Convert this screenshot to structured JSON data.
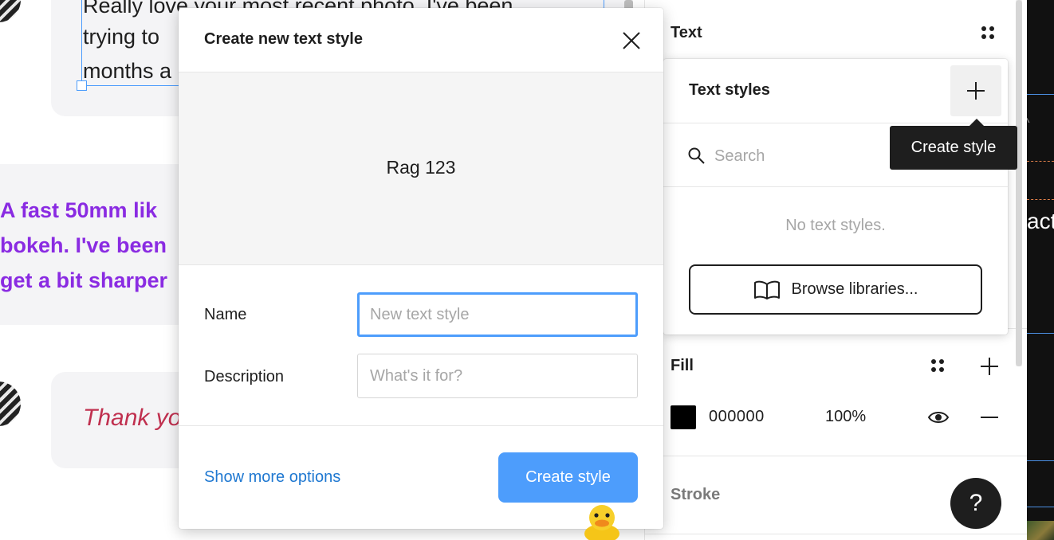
{
  "canvas": {
    "message1_lines": [
      "Really love your most recent photo. I've been",
      "trying to",
      "months a"
    ],
    "message2_lines": [
      "A fast 50mm lik",
      "bokeh. I've been",
      "get a bit sharper"
    ],
    "message3": "Thank yo"
  },
  "modal": {
    "title": "Create new text style",
    "close_icon": "close-icon",
    "preview_text": "Rag 123",
    "name_label": "Name",
    "name_placeholder": "New text style",
    "description_label": "Description",
    "description_placeholder": "What's it for?",
    "show_more_label": "Show more options",
    "create_label": "Create style"
  },
  "props": {
    "text_title": "Text",
    "fill_title": "Fill",
    "fill_hex": "000000",
    "fill_opacity": "100%",
    "fill_color": "#000000",
    "stroke_title": "Stroke"
  },
  "styles_popover": {
    "title": "Text styles",
    "search_placeholder": "Search",
    "empty_message": "No text styles.",
    "browse_label": "Browse libraries...",
    "tooltip": "Create style"
  },
  "right_strip": {
    "text": "act"
  },
  "help": {
    "label": "?"
  },
  "colors": {
    "accent": "#4d9dfc",
    "link": "#1f78d1",
    "purple_text": "#8a2be2",
    "red_text": "#c0304f"
  }
}
